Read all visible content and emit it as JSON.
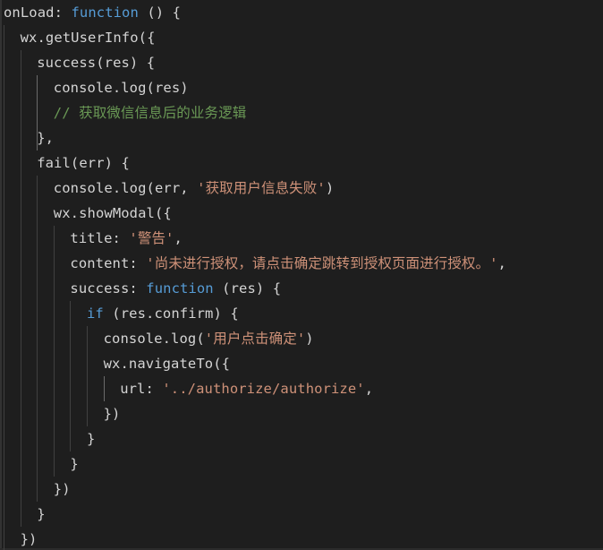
{
  "editor": {
    "name": "code-editor",
    "language": "javascript",
    "theme": "dark-plus",
    "background": "#1e1e1e",
    "font_size_px": 15.5,
    "line_height_px": 28,
    "colors": {
      "foreground": "#d4d4d4",
      "keyword": "#569cd6",
      "string": "#ce9178",
      "comment": "#6a9955",
      "indent_guide": "#404040",
      "indent_guide_active": "#6b6b6b",
      "edge": "#333333"
    }
  },
  "lines": [
    {
      "indent": 0,
      "tokens": [
        {
          "t": "onLoad",
          "c": "plain"
        },
        {
          "t": ": ",
          "c": "punc"
        },
        {
          "t": "function",
          "c": "kw"
        },
        {
          "t": " () {",
          "c": "punc"
        }
      ]
    },
    {
      "indent": 1,
      "tokens": [
        {
          "t": "wx.getUserInfo({",
          "c": "plain"
        }
      ]
    },
    {
      "indent": 2,
      "tokens": [
        {
          "t": "success(res) {",
          "c": "plain"
        }
      ]
    },
    {
      "indent": 3,
      "tokens": [
        {
          "t": "console.log(res)",
          "c": "plain"
        }
      ]
    },
    {
      "indent": 3,
      "tokens": [
        {
          "t": "// 获取微信信息后的业务逻辑",
          "c": "com"
        }
      ]
    },
    {
      "indent": 2,
      "tokens": [
        {
          "t": "},",
          "c": "plain"
        }
      ]
    },
    {
      "indent": 2,
      "tokens": [
        {
          "t": "fail(err) {",
          "c": "plain"
        }
      ]
    },
    {
      "indent": 3,
      "tokens": [
        {
          "t": "console.log(err, ",
          "c": "plain"
        },
        {
          "t": "'获取用户信息失败'",
          "c": "str"
        },
        {
          "t": ")",
          "c": "plain"
        }
      ]
    },
    {
      "indent": 3,
      "tokens": [
        {
          "t": "wx.showModal({",
          "c": "plain"
        }
      ]
    },
    {
      "indent": 4,
      "tokens": [
        {
          "t": "title: ",
          "c": "plain"
        },
        {
          "t": "'警告'",
          "c": "str"
        },
        {
          "t": ",",
          "c": "plain"
        }
      ]
    },
    {
      "indent": 4,
      "tokens": [
        {
          "t": "content: ",
          "c": "plain"
        },
        {
          "t": "'尚未进行授权，请点击确定跳转到授权页面进行授权。'",
          "c": "str"
        },
        {
          "t": ",",
          "c": "plain"
        }
      ]
    },
    {
      "indent": 4,
      "tokens": [
        {
          "t": "success: ",
          "c": "plain"
        },
        {
          "t": "function",
          "c": "kw"
        },
        {
          "t": " (res) {",
          "c": "plain"
        }
      ]
    },
    {
      "indent": 5,
      "tokens": [
        {
          "t": "if",
          "c": "kw"
        },
        {
          "t": " (res.confirm) {",
          "c": "plain"
        }
      ]
    },
    {
      "indent": 6,
      "tokens": [
        {
          "t": "console.log(",
          "c": "plain"
        },
        {
          "t": "'用户点击确定'",
          "c": "str"
        },
        {
          "t": ")",
          "c": "plain"
        }
      ]
    },
    {
      "indent": 6,
      "tokens": [
        {
          "t": "wx.navigateTo({",
          "c": "plain"
        }
      ]
    },
    {
      "indent": 7,
      "tokens": [
        {
          "t": "url: ",
          "c": "plain"
        },
        {
          "t": "'../authorize/authorize'",
          "c": "str"
        },
        {
          "t": ",",
          "c": "plain"
        }
      ]
    },
    {
      "indent": 6,
      "tokens": [
        {
          "t": "})",
          "c": "plain"
        }
      ]
    },
    {
      "indent": 5,
      "tokens": [
        {
          "t": "}",
          "c": "plain"
        }
      ]
    },
    {
      "indent": 4,
      "tokens": [
        {
          "t": "}",
          "c": "plain"
        }
      ]
    },
    {
      "indent": 3,
      "tokens": [
        {
          "t": "})",
          "c": "plain"
        }
      ]
    },
    {
      "indent": 2,
      "tokens": [
        {
          "t": "}",
          "c": "plain"
        }
      ]
    },
    {
      "indent": 1,
      "tokens": [
        {
          "t": "})",
          "c": "plain"
        }
      ]
    }
  ],
  "indent_guides": [
    {
      "col": 1,
      "from_line": 1,
      "to_line": 21,
      "active": false
    },
    {
      "col": 2,
      "from_line": 2,
      "to_line": 20,
      "active": false
    },
    {
      "col": 3,
      "from_line": 3,
      "to_line": 5,
      "active": true
    },
    {
      "col": 3,
      "from_line": 7,
      "to_line": 19,
      "active": false
    },
    {
      "col": 4,
      "from_line": 9,
      "to_line": 18,
      "active": false
    },
    {
      "col": 5,
      "from_line": 12,
      "to_line": 17,
      "active": false
    },
    {
      "col": 6,
      "from_line": 13,
      "to_line": 16,
      "active": false
    },
    {
      "col": 7,
      "from_line": 15,
      "to_line": 15,
      "active": true
    }
  ]
}
